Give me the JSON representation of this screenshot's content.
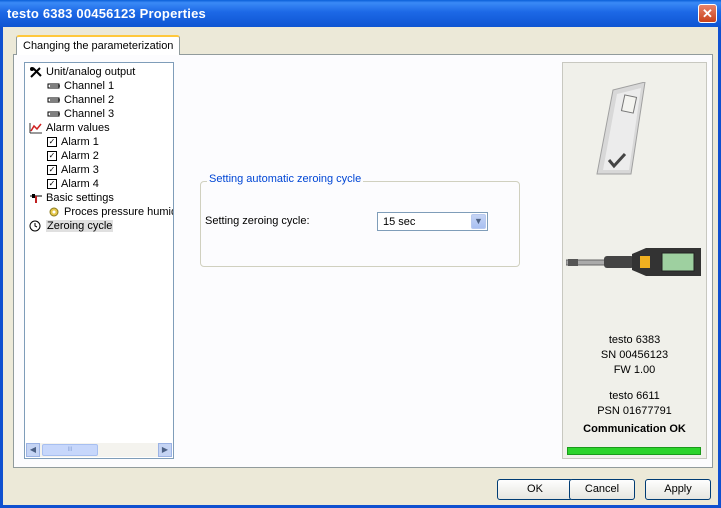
{
  "window": {
    "title": "testo 6383  00456123 Properties"
  },
  "tab": {
    "label": "Changing the parameterization"
  },
  "tree": {
    "items": [
      {
        "label": "Unit/analog output",
        "icon": "tools-icon"
      },
      {
        "label": "Channel 1",
        "icon": "channel-icon"
      },
      {
        "label": "Channel 2",
        "icon": "channel-icon"
      },
      {
        "label": "Channel 3",
        "icon": "channel-icon"
      },
      {
        "label": "Alarm values",
        "icon": "alarm-chart-icon"
      },
      {
        "label": "Alarm 1",
        "icon": "checkbox-icon"
      },
      {
        "label": "Alarm 2",
        "icon": "checkbox-icon"
      },
      {
        "label": "Alarm 3",
        "icon": "checkbox-icon"
      },
      {
        "label": "Alarm 4",
        "icon": "checkbox-icon"
      },
      {
        "label": "Basic settings",
        "icon": "sliders-icon"
      },
      {
        "label": "Proces pressure humidity",
        "icon": "gear-icon"
      },
      {
        "label": "Zeroing cycle",
        "icon": "clock-icon"
      }
    ],
    "scroll_thumb_grip": "III"
  },
  "zeroing": {
    "group_title": "Setting automatic zeroing cycle",
    "field_label": "Setting zeroing cycle:",
    "value": "15 sec"
  },
  "device": {
    "name": "testo 6383",
    "serial": "SN 00456123",
    "firmware": "FW  1.00",
    "probe": "testo 6611",
    "probe_serial": "PSN 01677791",
    "status": "Communication OK",
    "progress": 1.0,
    "status_color": "#2bd42b"
  },
  "buttons": {
    "ok": "OK",
    "cancel": "Cancel",
    "apply": "Apply"
  },
  "colors": {
    "titlebar": "#0a5fd8",
    "group_title": "#0046d5"
  }
}
